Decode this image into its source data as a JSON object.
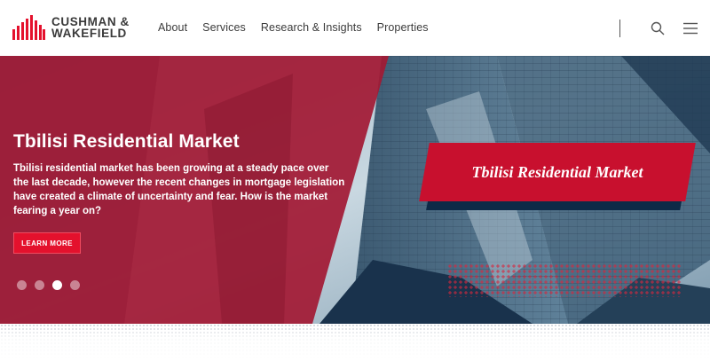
{
  "brand": {
    "line1": "CUSHMAN &",
    "line2": "WAKEFIELD"
  },
  "nav": {
    "items": [
      {
        "label": "About"
      },
      {
        "label": "Services"
      },
      {
        "label": "Research & Insights"
      },
      {
        "label": "Properties"
      }
    ]
  },
  "header_icons": {
    "search": "search-icon",
    "menu": "hamburger-menu-icon"
  },
  "hero": {
    "title": "Tbilisi Residential Market",
    "description": "Tbilisi residential market has been growing at a steady pace over the last decade, however the recent changes in mortgage legislation have created a climate of uncertainty and fear. How is the market fearing a year on?",
    "cta_label": "LEARN MORE",
    "card_title": "Tbilisi Residential Market",
    "slides_total": 4,
    "active_slide": 3
  },
  "colors": {
    "brand_red": "#e4112d",
    "overlay_red": "#a31a35",
    "card_red": "#c8102e",
    "card_shadow": "#0e2a47"
  }
}
